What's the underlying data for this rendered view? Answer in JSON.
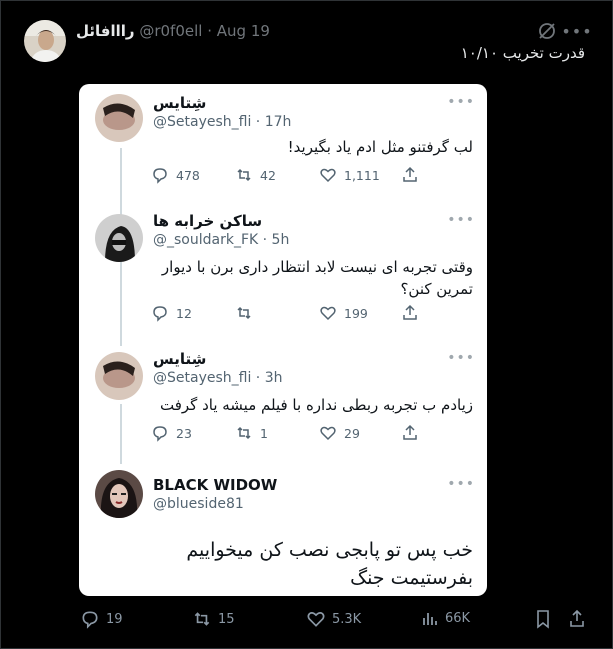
{
  "tweet": {
    "author_name": "رااافائل",
    "author_handle": "@r0f0ell",
    "date": "· Aug 19",
    "text": "قدرت تخریب ۱۰/۱۰",
    "stats": {
      "replies": "19",
      "retweets": "15",
      "likes": "5.3K",
      "views": "66K"
    }
  },
  "screenshot_thread": [
    {
      "name": "شِتایس",
      "handle": "@Setayesh_fli",
      "time": "· 17h",
      "text": "لب گرفتنو مثل ادم یاد بگیرید!",
      "replies": "478",
      "retweets": "42",
      "likes": "1,111"
    },
    {
      "name": "ساکن خرابه ها",
      "handle": "@_souldark_FK",
      "time": "· 5h",
      "text_line1": "وقتی تجربه ای نیست لابد انتظار داری برن با دیوار",
      "text_line2": "تمرین کنن؟",
      "replies": "12",
      "retweets": "",
      "likes": "199"
    },
    {
      "name": "شِتایس",
      "handle": "@Setayesh_fli",
      "time": "· 3h",
      "text": "زیادم ب تجربه ربطی نداره با فیلم میشه یاد گرفت",
      "replies": "23",
      "retweets": "1",
      "likes": "29"
    },
    {
      "name": "BLACK WIDOW",
      "handle": "@blueside81",
      "text_line1": "خب پس تو پابجی نصب کن میخواییم",
      "text_line2": "بفرستیمت جنگ"
    }
  ],
  "colors": {
    "background": "#000000",
    "card": "#ffffff",
    "muted": "#71767b",
    "text_dark": "#0f1419"
  }
}
